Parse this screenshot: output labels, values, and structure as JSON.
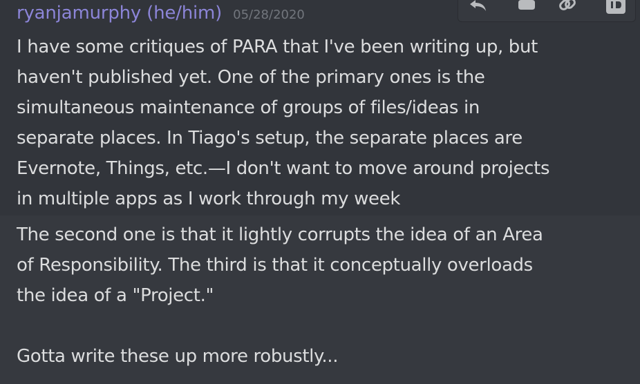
{
  "message": {
    "author": "ryanjamurphy (he/him)",
    "timestamp": "05/28/2020",
    "paragraph_1": [
      "I have some critiques of PARA that I've been writing up, but",
      "haven't published yet. One of the primary ones is the",
      "simultaneous maintenance of groups of files/ideas in",
      "separate places. In Tiago's setup, the separate places are",
      "Evernote, Things, etc.—I don't want to move around projects",
      "in multiple apps as I work through my week"
    ],
    "paragraph_2": [
      "The second one is that it lightly corrupts the idea of an Area",
      "of Responsibility. The third is that it conceptually overloads",
      "the idea of a \"Project.\""
    ],
    "paragraph_3": [
      "Gotta write these up more robustly..."
    ]
  },
  "toolbar": {
    "icons": [
      "reply-icon",
      "react-icon",
      "link-icon",
      "id-icon"
    ]
  },
  "colors": {
    "background": "#36393f",
    "hover_background": "#32353b",
    "username": "#8c85d8",
    "timestamp": "#72767d",
    "text": "#dcddde"
  }
}
